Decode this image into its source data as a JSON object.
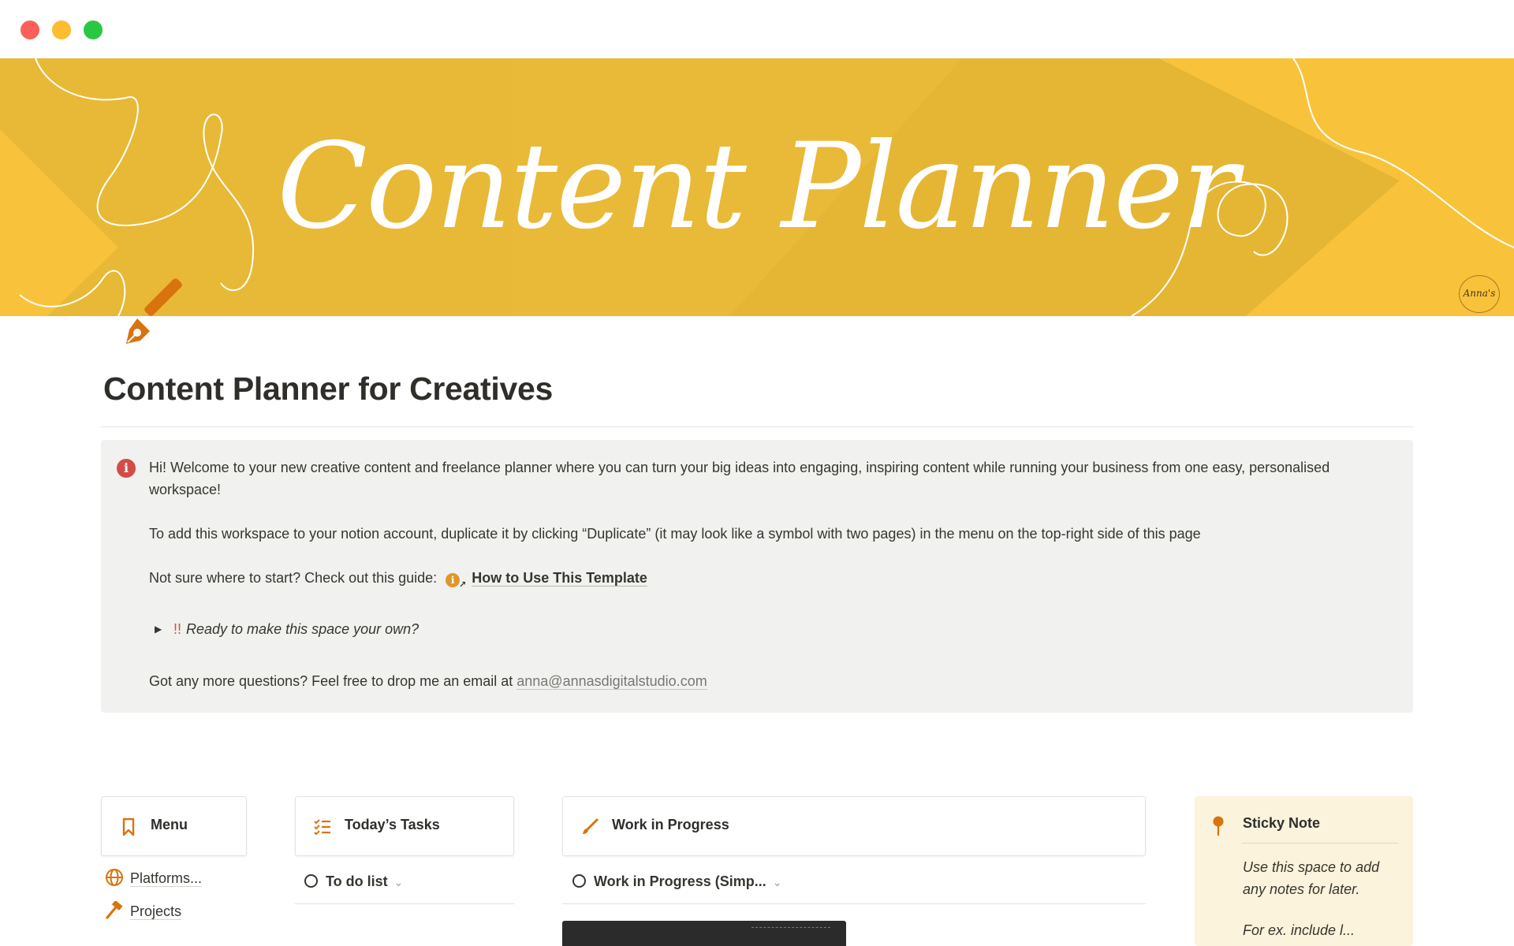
{
  "cover": {
    "title": "Content Planner",
    "signature": "Anna's"
  },
  "page": {
    "title": "Content Planner for Creatives",
    "icon": "fountain-pen-icon"
  },
  "callout": {
    "icon": "info-icon",
    "welcome": "Hi! Welcome to your new creative content and freelance planner where you can turn your big ideas into engaging, inspiring content while running your business from one easy, personalised workspace!",
    "duplicate": "To add this workspace to your notion account, duplicate it by clicking “Duplicate” (it may look like a symbol with two pages) in the menu on the top-right side of this page",
    "guide_prefix": "Not sure where to start? Check out this guide:",
    "guide_link": "How to Use This Template",
    "toggle_bang": "!!",
    "toggle_text": "Ready to make this space your own?",
    "questions_prefix": "Got any more questions? Feel free to drop me an email at",
    "email": "anna@annasdigitalstudio.com"
  },
  "cards": {
    "menu": "Menu",
    "tasks": "Today’s Tasks",
    "wip": "Work in Progress"
  },
  "links": {
    "platforms": "Platforms...",
    "projects": "Projects"
  },
  "views": {
    "todo": "To do list",
    "wip": "Work in Progress (Simp..."
  },
  "sticky": {
    "title": "Sticky Note",
    "text": "Use this space to add any notes for later.",
    "more": "For ex. include l..."
  },
  "colors": {
    "cover_yellow": "#f8c33a",
    "accent_orange": "#d9730d",
    "callout_bg": "#f1f1ef",
    "sticky_bg": "#fbf3db"
  }
}
